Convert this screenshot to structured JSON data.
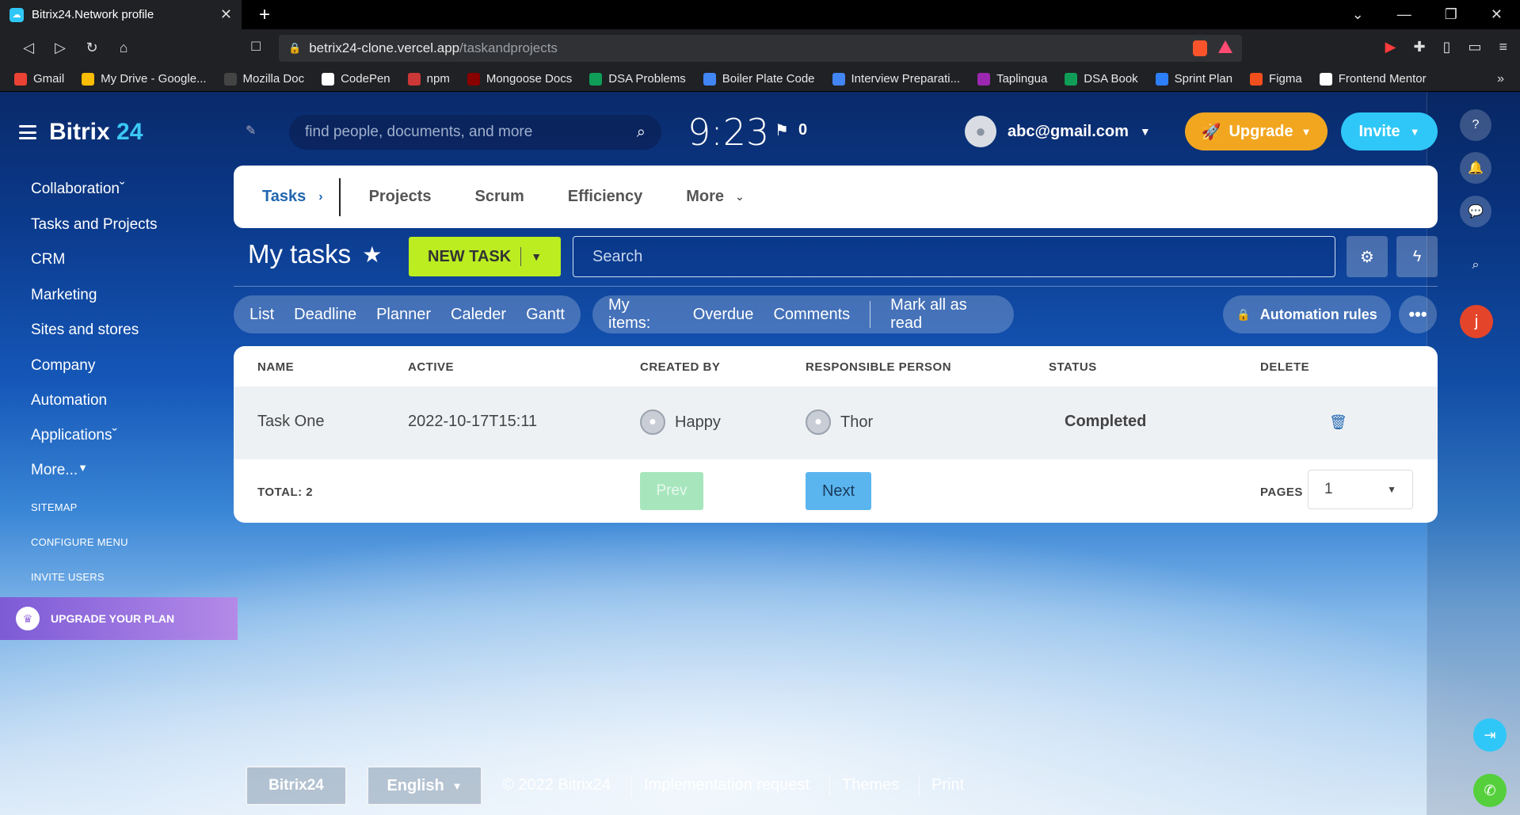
{
  "browser": {
    "tab_title": "Bitrix24.Network profile",
    "url_host": "betrix24-clone.vercel.app",
    "url_path": "/taskandprojects",
    "bookmarks": [
      {
        "label": "Gmail",
        "color": "#ea4335"
      },
      {
        "label": "My Drive - Google...",
        "color": "#fbbc04"
      },
      {
        "label": "Mozilla Doc",
        "color": "#444444"
      },
      {
        "label": "CodePen",
        "color": "#ffffff"
      },
      {
        "label": "npm",
        "color": "#cb3837"
      },
      {
        "label": "Mongoose Docs",
        "color": "#880000"
      },
      {
        "label": "DSA Problems",
        "color": "#0f9d58"
      },
      {
        "label": "Boiler Plate Code",
        "color": "#4285f4"
      },
      {
        "label": "Interview Preparati...",
        "color": "#4285f4"
      },
      {
        "label": "Taplingua",
        "color": "#9c27b0"
      },
      {
        "label": "DSA Book",
        "color": "#0f9d58"
      },
      {
        "label": "Sprint Plan",
        "color": "#2d7ff9"
      },
      {
        "label": "Figma",
        "color": "#f24e1e"
      },
      {
        "label": "Frontend Mentor",
        "color": "#ffffff"
      }
    ]
  },
  "sidebar": {
    "logo_word": "Bitrix",
    "logo_num": "24",
    "items": [
      {
        "label": "Collaboration",
        "caret": "ˇ"
      },
      {
        "label": "Tasks and Projects"
      },
      {
        "label": "CRM"
      },
      {
        "label": "Marketing"
      },
      {
        "label": "Sites and stores"
      },
      {
        "label": "Company"
      },
      {
        "label": "Automation"
      },
      {
        "label": "Applications",
        "caret": "ˇ"
      },
      {
        "label": "More...",
        "caret": "▼"
      }
    ],
    "small_items": [
      "SITEMAP",
      "CONFIGURE MENU",
      "INVITE USERS"
    ],
    "upgrade_plan": "UPGRADE YOUR PLAN"
  },
  "header": {
    "search_placeholder": "find people, documents, and more",
    "time": "9:23",
    "flag_count": "0",
    "user_email": "abc@gmail.com",
    "upgrade_label": "Upgrade",
    "invite_label": "Invite"
  },
  "topnav": {
    "active": "Tasks",
    "tabs": [
      "Projects",
      "Scrum",
      "Efficiency",
      "More"
    ]
  },
  "title_row": {
    "title": "My tasks",
    "new_task": "NEW TASK",
    "search_placeholder": "Search"
  },
  "filters": {
    "views": [
      "List",
      "Deadline",
      "Planner",
      "Caleder",
      "Gantt"
    ],
    "my_items_label": "My items:",
    "my_items": [
      "Overdue",
      "Comments"
    ],
    "mark_read": "Mark all as read",
    "automation": "Automation rules"
  },
  "table": {
    "columns": [
      "NAME",
      "ACTIVE",
      "CREATED BY",
      "RESPONSIBLE PERSON",
      "STATUS",
      "DELETE"
    ],
    "rows": [
      {
        "name": "Task One",
        "active": "2022-10-17T15:11",
        "created_by": "Happy",
        "responsible": "Thor",
        "status": "Completed"
      }
    ],
    "total": "TOTAL: 2",
    "prev": "Prev",
    "next": "Next",
    "pages_label": "PAGES",
    "page_value": "1"
  },
  "rail": {
    "avatar_letter": "j"
  },
  "footer": {
    "brand": "Bitrix24",
    "language": "English",
    "copyright": "© 2022 Bitrix24",
    "links": [
      "Implementation request",
      "Themes",
      "Print"
    ]
  },
  "colors": {
    "accent_blue": "#2fc7f7",
    "upgrade_orange": "#f2a620",
    "new_task_green": "#bbed21",
    "plan_purple": "#9a70e0",
    "avatar_red": "#e4452a"
  }
}
